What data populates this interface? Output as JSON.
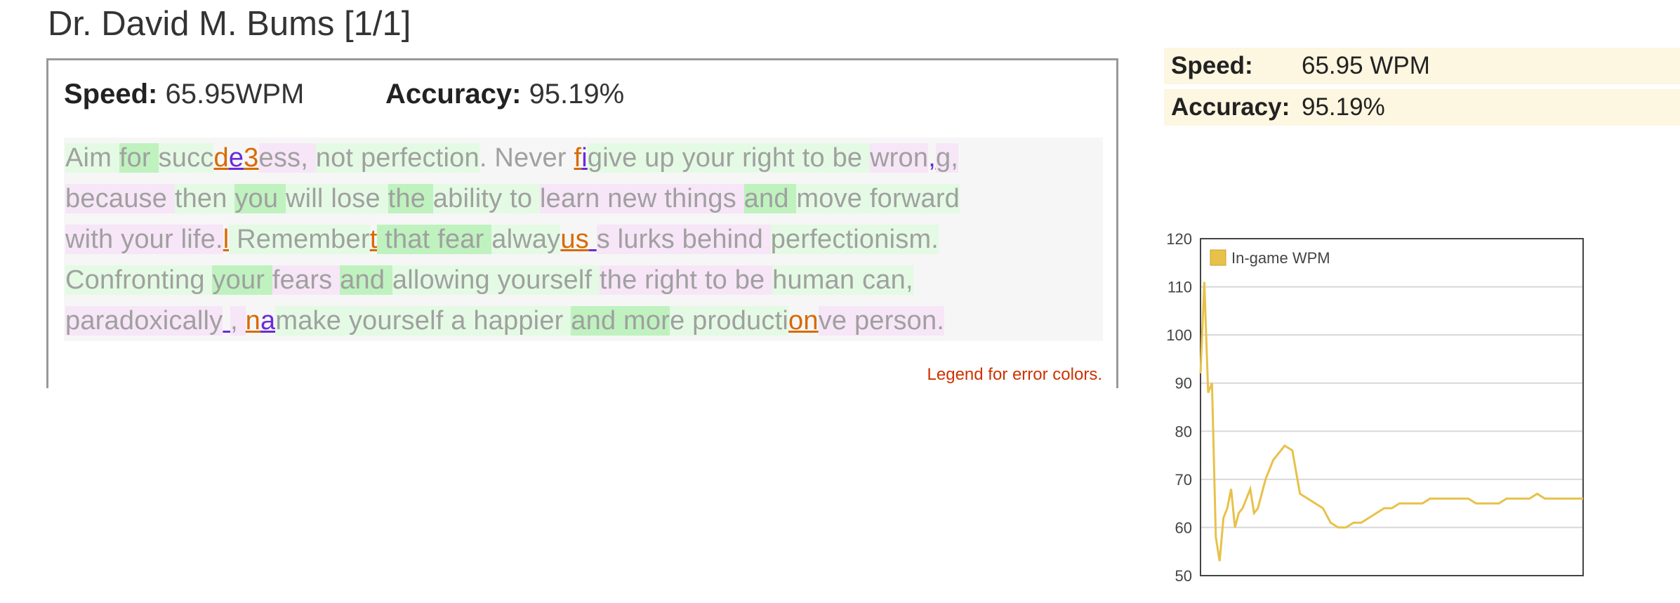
{
  "header": {
    "title": "Dr. David M. Bums [1/1]"
  },
  "stats": {
    "speed_label": "Speed:",
    "speed_value": "65.95WPM",
    "accuracy_label": "Accuracy:",
    "accuracy_value": "95.19%"
  },
  "legend_link": "Legend for error colors.",
  "side_stats": {
    "speed_label": "Speed:",
    "speed_value": "65.95 WPM",
    "accuracy_label": "Accuracy:",
    "accuracy_value": "95.19%"
  },
  "typed_text": {
    "lines": [
      [
        [
          "Aim ",
          "g"
        ],
        [
          "for ",
          "G"
        ],
        [
          "succ",
          "g"
        ],
        [
          "d",
          "o"
        ],
        [
          "e",
          "v"
        ],
        [
          "3",
          "o"
        ],
        [
          "ess, ",
          "p"
        ],
        [
          "not ",
          "g"
        ],
        [
          "perfection",
          "g"
        ],
        [
          ". Never ",
          "n"
        ],
        [
          "f",
          "o"
        ],
        [
          "i",
          "v"
        ],
        [
          "give up your right to be ",
          "g"
        ],
        [
          "wron",
          "p"
        ],
        [
          ",",
          "v"
        ],
        [
          "g,",
          "p"
        ]
      ],
      [
        [
          "because ",
          "p"
        ],
        [
          "then ",
          "g"
        ],
        [
          "you ",
          "G"
        ],
        [
          "will lose ",
          "g"
        ],
        [
          "the ",
          "G"
        ],
        [
          "ability to ",
          "g"
        ],
        [
          "learn new things ",
          "p"
        ],
        [
          "and ",
          "G"
        ],
        [
          "move forward",
          "g"
        ]
      ],
      [
        [
          "with your life.",
          "p"
        ],
        [
          "l",
          "o"
        ],
        [
          " Remember",
          "g"
        ],
        [
          "t",
          "o"
        ],
        [
          " that fear ",
          "G"
        ],
        [
          "alway",
          "g"
        ],
        [
          "us",
          "o"
        ],
        [
          " ",
          "v"
        ],
        [
          "s lurks behind ",
          "p"
        ],
        [
          "perfectionism.",
          "g"
        ]
      ],
      [
        [
          "Confronting ",
          "g"
        ],
        [
          "your ",
          "G"
        ],
        [
          "fears ",
          "p"
        ],
        [
          "and ",
          "G"
        ],
        [
          "allowing yourself ",
          "g"
        ],
        [
          "the right to be ",
          "p"
        ],
        [
          "human can,",
          "g"
        ]
      ],
      [
        [
          "paradoxically",
          "p"
        ],
        [
          " ",
          "v"
        ],
        [
          ", ",
          "p"
        ],
        [
          "n",
          "o"
        ],
        [
          "a",
          "v"
        ],
        [
          "make yourself a happier ",
          "g"
        ],
        [
          "and mor",
          "G"
        ],
        [
          "e producti",
          "g"
        ],
        [
          "on",
          "o"
        ],
        [
          "ve person.",
          "p"
        ]
      ]
    ]
  },
  "chart_data": {
    "type": "line",
    "series": [
      {
        "name": "In-game WPM",
        "color": "#e8c14a",
        "x": [
          0,
          1,
          2,
          3,
          4,
          5,
          6,
          7,
          8,
          9,
          10,
          11,
          12,
          13,
          14,
          15,
          16,
          17,
          18,
          19,
          20,
          22,
          24,
          26,
          28,
          30,
          32,
          34,
          36,
          38,
          40,
          42,
          44,
          46,
          48,
          50,
          52,
          54,
          56,
          58,
          60,
          62,
          64,
          66,
          68,
          70,
          72,
          74,
          76,
          78,
          80,
          82,
          84,
          86,
          88,
          90,
          92,
          94,
          96,
          98,
          100
        ],
        "y": [
          92,
          111,
          88,
          90,
          58,
          53,
          62,
          64,
          68,
          60,
          63,
          64,
          66,
          68,
          63,
          64,
          67,
          70,
          72,
          74,
          75,
          77,
          76,
          67,
          66,
          65,
          64,
          61,
          60,
          60,
          61,
          61,
          62,
          63,
          64,
          64,
          65,
          65,
          65,
          65,
          66,
          66,
          66,
          66,
          66,
          66,
          65,
          65,
          65,
          65,
          66,
          66,
          66,
          66,
          67,
          66,
          66,
          66,
          66,
          66,
          66
        ]
      }
    ],
    "xlim": [
      0,
      100
    ],
    "ylim": [
      50,
      120
    ],
    "yticks": [
      50,
      60,
      70,
      80,
      90,
      100,
      110,
      120
    ],
    "grid": true,
    "legend": "top-left"
  }
}
